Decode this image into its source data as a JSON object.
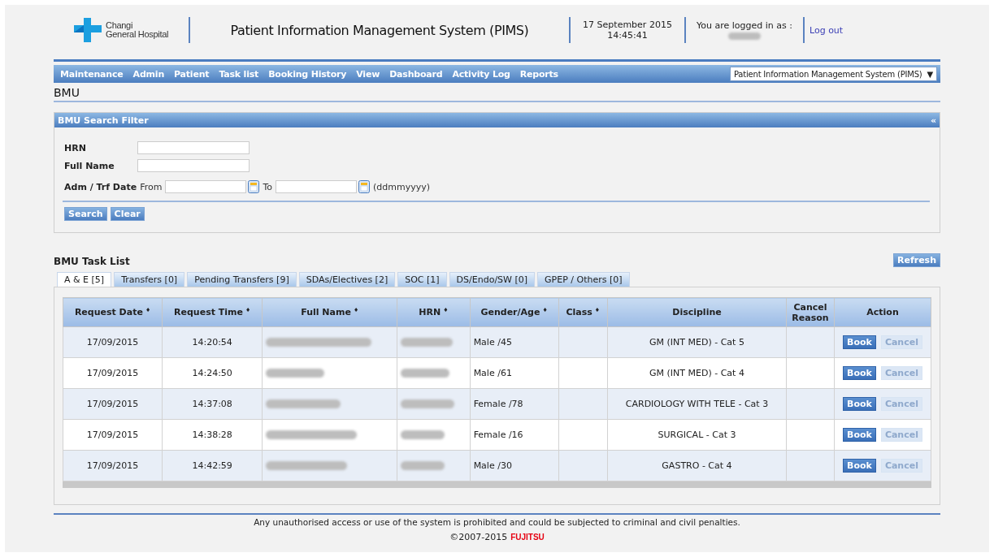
{
  "header": {
    "logo_line1": "Changi",
    "logo_line2": "General Hospital",
    "title": "Patient Information Management System (PIMS)",
    "date": "17 September 2015",
    "time": "14:45:41",
    "login_label": "You are logged in as :",
    "logout": "Log out"
  },
  "menu": [
    "Maintenance",
    "Admin",
    "Patient",
    "Task list",
    "Booking History",
    "View",
    "Dashboard",
    "Activity Log",
    "Reports"
  ],
  "system_select": {
    "value": "Patient Information Management System (PIMS)",
    "caret": "▼"
  },
  "page_title": "BMU",
  "filter": {
    "title": "BMU Search Filter",
    "collapse": "«",
    "hrn_label": "HRN",
    "name_label": "Full Name",
    "date_label": "Adm / Trf Date",
    "from_label": "From",
    "to_label": "To",
    "format_hint": "(ddmmyyyy)",
    "buttons": [
      "Search",
      "Clear"
    ]
  },
  "task_list": {
    "title": "BMU Task List",
    "refresh": "Refresh",
    "tabs": [
      {
        "label": "A & E [5]",
        "selected": true
      },
      {
        "label": "Transfers [0]",
        "selected": false
      },
      {
        "label": "Pending Transfers [9]",
        "selected": false
      },
      {
        "label": "SDAs/Electives [2]",
        "selected": false
      },
      {
        "label": "SOC [1]",
        "selected": false
      },
      {
        "label": "DS/Endo/SW [0]",
        "selected": false
      },
      {
        "label": "GPEP / Others [0]",
        "selected": false
      }
    ],
    "columns": [
      {
        "label": "Request Date",
        "sortable": true
      },
      {
        "label": "Request Time",
        "sortable": true
      },
      {
        "label": "Full Name",
        "sortable": true
      },
      {
        "label": "HRN",
        "sortable": true
      },
      {
        "label": "Gender/Age",
        "sortable": true
      },
      {
        "label": "Class",
        "sortable": true
      },
      {
        "label": "Discipline",
        "sortable": false
      },
      {
        "label": "Cancel Reason",
        "sortable": false
      },
      {
        "label": "Action",
        "sortable": false
      }
    ],
    "sort_mark": "♦",
    "rows": [
      {
        "date": "17/09/2015",
        "time": "14:20:54",
        "gender_age": "Male /45",
        "discipline": "GM (INT MED) - Cat 5",
        "book": "Book",
        "cancel": "Cancel",
        "cancel_disabled": true
      },
      {
        "date": "17/09/2015",
        "time": "14:24:50",
        "gender_age": "Male /61",
        "discipline": "GM (INT MED) - Cat 4",
        "book": "Book",
        "cancel": "Cancel",
        "cancel_disabled": true
      },
      {
        "date": "17/09/2015",
        "time": "14:37:08",
        "gender_age": "Female /78",
        "discipline": "CARDIOLOGY WITH TELE - Cat 3",
        "book": "Book",
        "cancel": "Cancel",
        "cancel_disabled": true
      },
      {
        "date": "17/09/2015",
        "time": "14:38:28",
        "gender_age": "Female /16",
        "discipline": "SURGICAL - Cat 3",
        "book": "Book",
        "cancel": "Cancel",
        "cancel_disabled": true
      },
      {
        "date": "17/09/2015",
        "time": "14:42:59",
        "gender_age": "Male /30",
        "discipline": "GASTRO - Cat 4",
        "book": "Book",
        "cancel": "Cancel",
        "cancel_disabled": true
      }
    ]
  },
  "footer": {
    "notice": "Any unauthorised access or use of the system is prohibited and could be subjected to criminal and civil penalties.",
    "copyright": "©2007-2015",
    "brand": "FUJITSU"
  }
}
